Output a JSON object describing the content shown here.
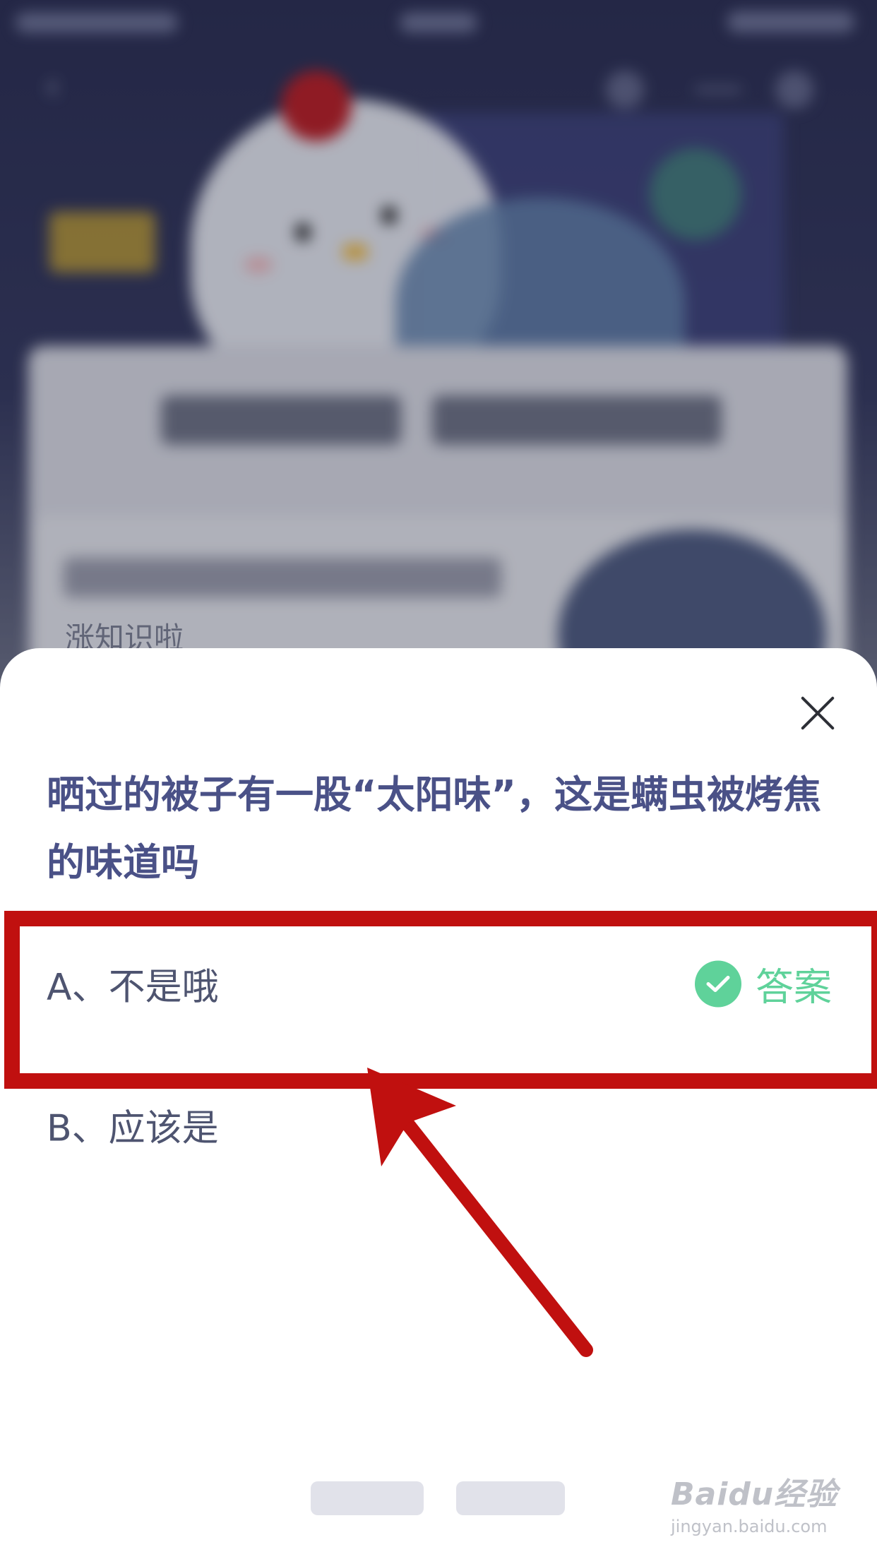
{
  "background": {
    "sub_label": "涨知识啦"
  },
  "question": {
    "text": "晒过的被子有一股“太阳味”，这是螨虫被烤焦的味道吗"
  },
  "options": [
    {
      "label": "A、不是哦",
      "is_answer": true,
      "answer_label": "答案"
    },
    {
      "label": "B、应该是",
      "is_answer": false
    }
  ],
  "colors": {
    "question": "#4a5187",
    "answer_green": "#5fd29a",
    "annotation_red": "#c0100f"
  },
  "watermark": {
    "main": "Baidu经验",
    "sub": "jingyan.baidu.com"
  }
}
